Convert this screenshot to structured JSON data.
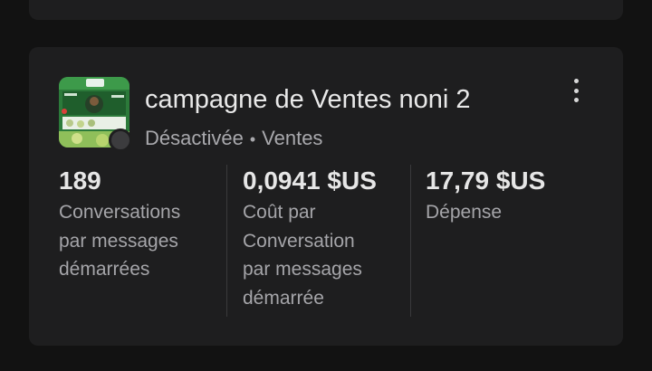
{
  "campaign": {
    "name": "campagne de Ventes noni 2",
    "status": "Désactivée",
    "separator": "•",
    "objective": "Ventes",
    "status_dot_color": "#3c3c3e",
    "menu_icon": "more-vertical-icon"
  },
  "metrics": [
    {
      "value": "189",
      "label_lines": [
        "Conversations",
        "par messages",
        "démarrées"
      ]
    },
    {
      "value": "0,0941 $US",
      "label_lines": [
        "Coût par",
        "Conversation",
        "par messages",
        "démarrée"
      ]
    },
    {
      "value": "17,79 $US",
      "label_lines": [
        "Dépense"
      ]
    }
  ],
  "colors": {
    "background": "#121212",
    "card": "#1e1e1f",
    "text_primary": "#e9e9e9",
    "text_secondary": "#a5a5a9"
  }
}
